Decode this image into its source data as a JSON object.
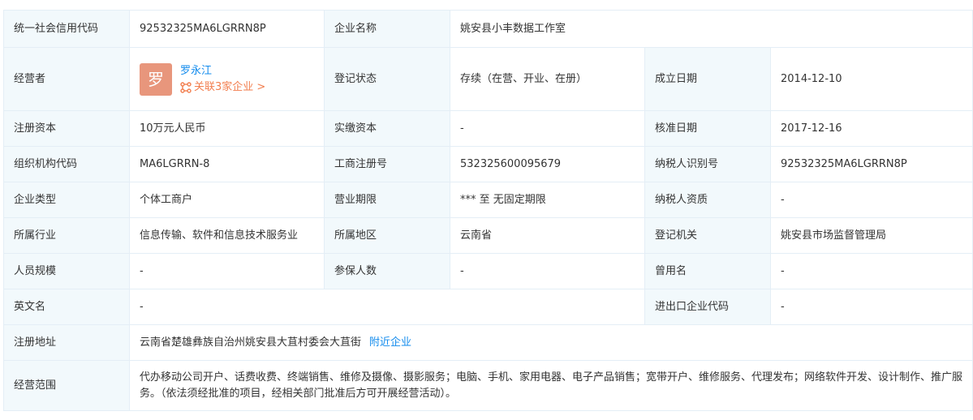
{
  "credit_code": {
    "label": "统一社会信用代码",
    "value": "92532325MA6LGRRN8P"
  },
  "company_name": {
    "label": "企业名称",
    "value": "姚安县小丰数据工作室"
  },
  "operator": {
    "label": "经营者",
    "avatar_char": "罗",
    "name": "罗永江",
    "related": "关联3家企业 >",
    "related_icon": "relation-icon"
  },
  "reg_status": {
    "label": "登记状态",
    "value": "存续（在营、开业、在册）"
  },
  "established": {
    "label": "成立日期",
    "value": "2014-12-10"
  },
  "reg_capital": {
    "label": "注册资本",
    "value": "10万元人民币"
  },
  "paid_capital": {
    "label": "实缴资本",
    "value": "-"
  },
  "approved_date": {
    "label": "核准日期",
    "value": "2017-12-16"
  },
  "org_code": {
    "label": "组织机构代码",
    "value": "MA6LGRRN-8"
  },
  "biz_reg_no": {
    "label": "工商注册号",
    "value": "532325600095679"
  },
  "taxpayer_id": {
    "label": "纳税人识别号",
    "value": "92532325MA6LGRRN8P"
  },
  "company_type": {
    "label": "企业类型",
    "value": "个体工商户"
  },
  "biz_term": {
    "label": "营业期限",
    "value": "*** 至 无固定期限"
  },
  "taxpayer_qual": {
    "label": "纳税人资质",
    "value": "-"
  },
  "industry": {
    "label": "所属行业",
    "value": "信息传输、软件和信息技术服务业"
  },
  "region": {
    "label": "所属地区",
    "value": "云南省"
  },
  "reg_authority": {
    "label": "登记机关",
    "value": "姚安县市场监督管理局"
  },
  "staff_size": {
    "label": "人员规模",
    "value": "-"
  },
  "insured": {
    "label": "参保人数",
    "value": "-"
  },
  "former_name": {
    "label": "曾用名",
    "value": "-"
  },
  "english_name": {
    "label": "英文名",
    "value": "-"
  },
  "ie_code": {
    "label": "进出口企业代码",
    "value": "-"
  },
  "reg_address": {
    "label": "注册地址",
    "value": "云南省楚雄彝族自治州姚安县大苴村委会大苴街",
    "link": "附近企业"
  },
  "biz_scope": {
    "label": "经营范围",
    "value": "代办移动公司开户、话费收费、终端销售、维修及摄像、摄影服务；电脑、手机、家用电器、电子产品销售；宽带开户、维修服务、代理发布；网络软件开发、设计制作、推广服务。（依法须经批准的项目，经相关部门批准后方可开展经营活动）。"
  },
  "colors": {
    "label_bg": "#f2f9fc",
    "border": "#e4eef6",
    "link": "#128bed",
    "related": "#f27e4e",
    "avatar": "#e8967c"
  }
}
